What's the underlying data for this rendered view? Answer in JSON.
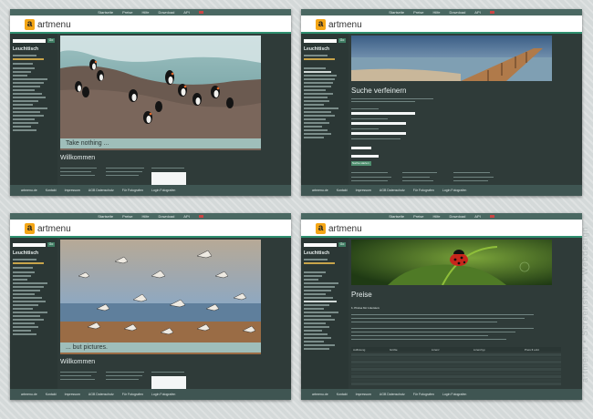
{
  "watermark": "artmenu • Screenshot • Webdesign",
  "colors": {
    "accent": "#2f8f6f",
    "logo": "#f4a616",
    "page_bg": "#2f3b39",
    "sidebar_bg": "#2b3735",
    "caption_bg": "#9fbeba"
  },
  "nav_items": [
    "Startseite",
    "Preise",
    "Hilfe",
    "Download",
    "API"
  ],
  "logo": {
    "letter": "a",
    "text": "artmenu"
  },
  "sidebar": {
    "title": "Leuchttisch",
    "go": "Go"
  },
  "footer_items": [
    "artmenu.de",
    "Kontakt",
    "Impressum",
    "AGB Datenschutz",
    "Für Fotografen",
    "Login Fotografen"
  ],
  "shots": {
    "tl": {
      "caption": "Take nothing ...",
      "welcome": "Willkommen"
    },
    "tr": {
      "heading": "Suche verfeinern",
      "btn": "Suche starten"
    },
    "bl": {
      "caption": "... but pictures.",
      "welcome": "Willkommen"
    },
    "br": {
      "heading": "Preise",
      "subheading": "1. Preise für Lizenzen",
      "table_head": [
        "Auflösung",
        "Größe",
        "Lizenz",
        "Lizenztyp",
        "Preis € exkl."
      ]
    }
  }
}
